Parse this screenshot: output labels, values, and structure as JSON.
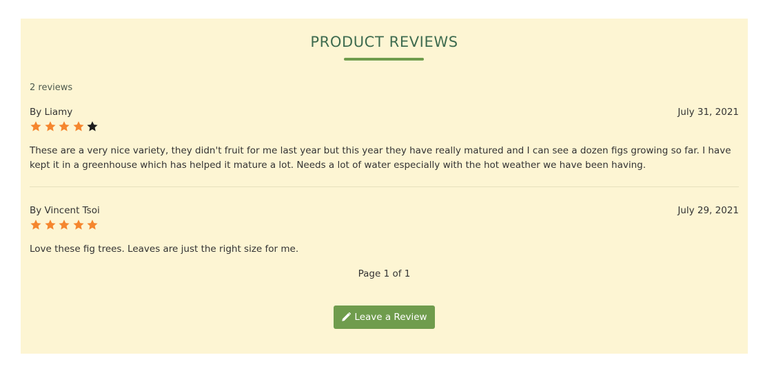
{
  "section": {
    "title": "PRODUCT REVIEWS",
    "review_count_label": "2 reviews",
    "colors": {
      "background": "#fdf5d3",
      "title": "#3e6b4f",
      "accent": "#6f9c4d",
      "star_filled": "#f5862e",
      "star_empty": "#1d1d1d"
    }
  },
  "reviews": [
    {
      "author": "By Liamy",
      "date": "July 31, 2021",
      "rating": 4,
      "max_rating": 5,
      "body": "These are a very nice variety, they didn't fruit for me last year but this year they have really matured and I can see a dozen figs growing so far. I have kept it in a greenhouse which has helped it mature a lot. Needs a lot of water especially with the hot weather we have been having."
    },
    {
      "author": "By Vincent Tsoi",
      "date": "July 29, 2021",
      "rating": 5,
      "max_rating": 5,
      "body": "Love these fig trees. Leaves are just the right size for me."
    }
  ],
  "pagination": {
    "label": "Page 1 of 1"
  },
  "actions": {
    "leave_review_label": "Leave a Review",
    "leave_review_icon": "pencil-icon"
  }
}
